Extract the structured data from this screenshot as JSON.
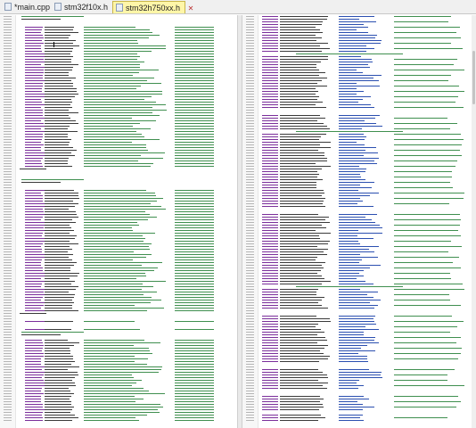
{
  "tabs": [
    {
      "label": "*main.cpp",
      "active": false,
      "closable": false
    },
    {
      "label": "stm32f10x.h",
      "active": false,
      "closable": false
    },
    {
      "label": "stm32h750xx.h",
      "active": true,
      "closable": true
    }
  ],
  "tab_close_glyph": "✕",
  "colors": {
    "tab_active_bg": "#fff6a8",
    "code_black": "#3a3a3a",
    "keyword_purple": "#7a2e9a",
    "comment_green": "#3f8f4f",
    "number_blue": "#2b4fb0"
  }
}
